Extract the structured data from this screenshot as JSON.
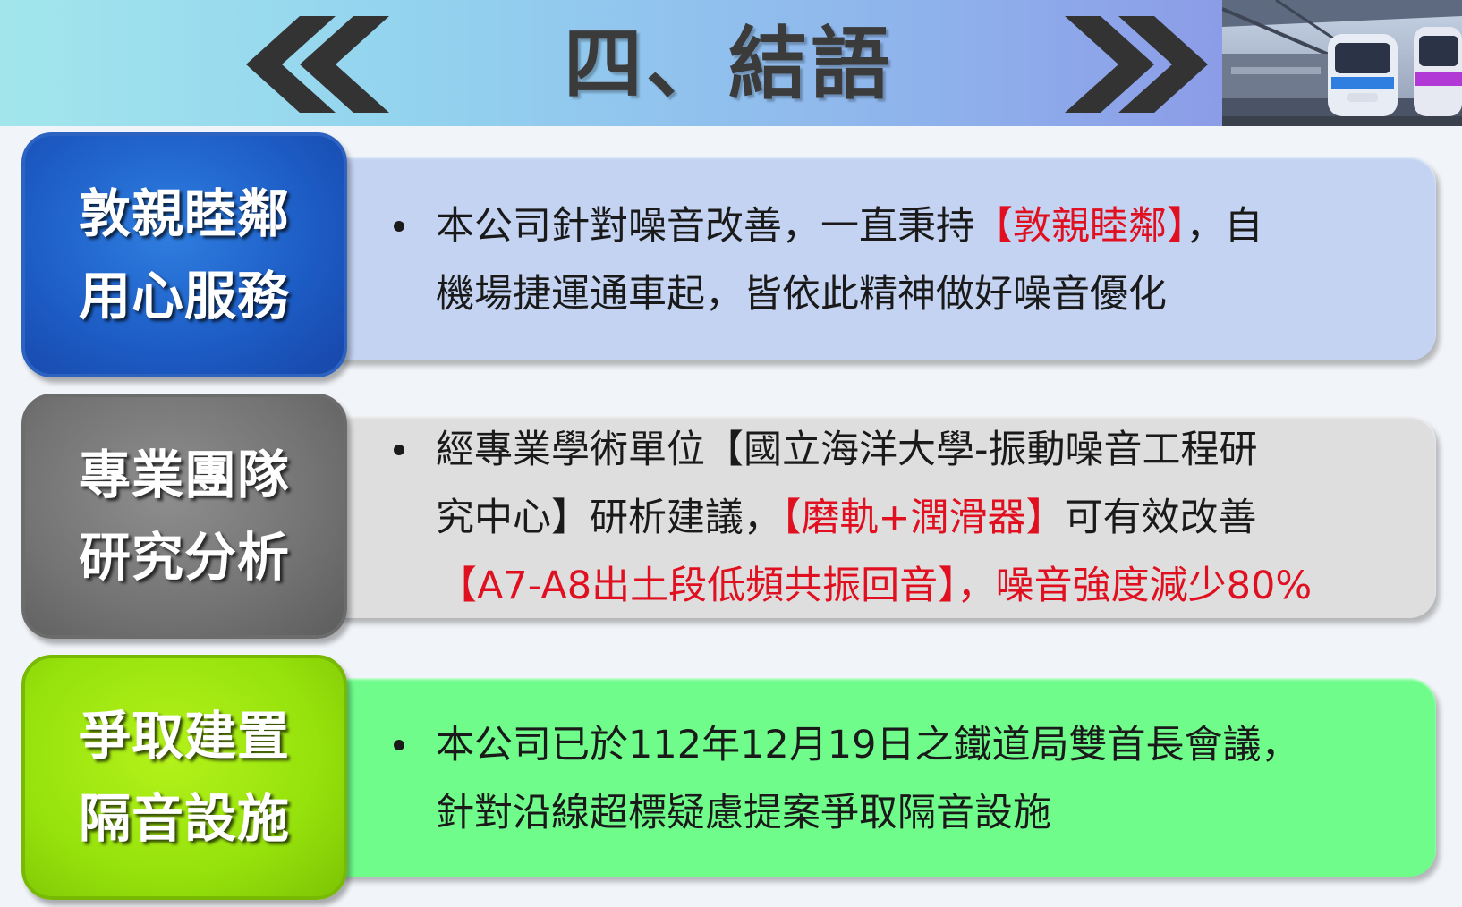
{
  "header": {
    "title": "四、結語"
  },
  "sections": [
    {
      "badge": [
        "敦親睦鄰",
        "用心服務"
      ],
      "lines": [
        [
          "本公司針對噪音改善，一直秉持",
          "【敦親睦鄰】",
          "，自"
        ],
        [
          "機場捷運通車起，皆依此精神做好噪音優化"
        ]
      ]
    },
    {
      "badge": [
        "專業團隊",
        "研究分析"
      ],
      "lines": [
        [
          "經專業學術單位【國立海洋大學-振動噪音工程研"
        ],
        [
          "究中心】研析建議，",
          "【磨軌+潤滑器】",
          "可有效改善"
        ],
        [
          "【A7-A8出土段低頻共振回音】，噪音強度減少80%"
        ]
      ]
    },
    {
      "badge": [
        "爭取建置",
        "隔音設施"
      ],
      "lines": [
        [
          "本公司已於112年12月19日之鐵道局雙首長會議，"
        ],
        [
          "針對沿線超標疑慮提案爭取隔音設施"
        ]
      ]
    }
  ],
  "colors": {
    "highlight": "#e01020",
    "badge_blue": "#1c5bc4",
    "badge_gray": "#737373",
    "badge_green": "#96e20c",
    "panel_blue": "#c4d3f1",
    "panel_gray": "#dedede",
    "panel_green": "#6ffc8a"
  },
  "icons": [
    "double-chevron-left-icon",
    "double-chevron-right-icon",
    "train-photo"
  ]
}
